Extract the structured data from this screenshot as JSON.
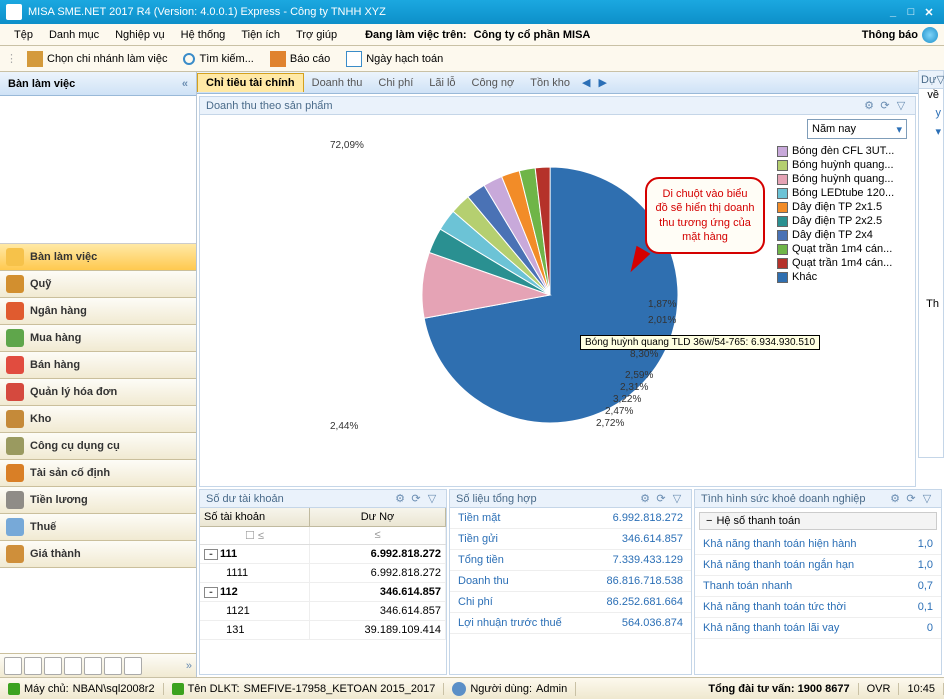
{
  "window": {
    "title": "MISA SME.NET 2017 R4 (Version: 4.0.0.1) Express - Công ty TNHH XYZ"
  },
  "menu": {
    "items": [
      "Tệp",
      "Danh mục",
      "Nghiệp vụ",
      "Hệ thống",
      "Tiện ích",
      "Trợ giúp"
    ],
    "working_on_label": "Đang làm việc trên:",
    "working_on_value": "Công ty cổ phần MISA",
    "notify": "Thông báo"
  },
  "toolbar": {
    "branch": "Chọn chi nhánh làm việc",
    "search": "Tìm kiếm...",
    "report": "Báo cáo",
    "accounting_date": "Ngày hạch toán"
  },
  "sidebar": {
    "title": "Bàn làm việc",
    "items": [
      {
        "label": "Bàn làm việc",
        "active": true,
        "color": "#f6c24a"
      },
      {
        "label": "Quỹ",
        "color": "#d28f2f"
      },
      {
        "label": "Ngân hàng",
        "color": "#e05b2f"
      },
      {
        "label": "Mua hàng",
        "color": "#5fa64b"
      },
      {
        "label": "Bán hàng",
        "color": "#e14c3f"
      },
      {
        "label": "Quản lý hóa đơn",
        "color": "#d5493e"
      },
      {
        "label": "Kho",
        "color": "#c58a39"
      },
      {
        "label": "Công cụ dụng cụ",
        "color": "#9a9a60"
      },
      {
        "label": "Tài sản cố định",
        "color": "#d97f26"
      },
      {
        "label": "Tiền lương",
        "color": "#8f8c87"
      },
      {
        "label": "Thuế",
        "color": "#77a9d8"
      },
      {
        "label": "Giá thành",
        "color": "#cf8f3a"
      }
    ]
  },
  "tabs": {
    "items": [
      "Chỉ tiêu tài chính",
      "Doanh thu",
      "Chi phí",
      "Lãi lỗ",
      "Công nợ",
      "Tồn kho"
    ]
  },
  "chart": {
    "title": "Doanh thu theo sản phẩm",
    "period": "Năm nay",
    "callout": "Di chuột vào biểu đồ sẽ hiển thị doanh thu tương ứng của mặt hàng",
    "tooltip": "Bóng huỳnh quang TLD 36w/54-765: 6.934.930.510",
    "legend": [
      {
        "label": "Bóng đèn CFL 3UT...",
        "color": "#c8a9da"
      },
      {
        "label": "Bóng huỳnh quang...",
        "color": "#b5cf70"
      },
      {
        "label": "Bóng huỳnh quang...",
        "color": "#e5a3b5"
      },
      {
        "label": "Bóng LEDtube 120...",
        "color": "#6cc3d6"
      },
      {
        "label": "Dây điện TP 2x1.5",
        "color": "#f28c28"
      },
      {
        "label": "Dây điện TP 2x2.5",
        "color": "#2a9091"
      },
      {
        "label": "Dây điện TP 2x4",
        "color": "#4a72b5"
      },
      {
        "label": "Quạt trần 1m4 cán...",
        "color": "#6fb548"
      },
      {
        "label": "Quạt trần 1m4 cán...",
        "color": "#b5322a"
      },
      {
        "label": "Khác",
        "color": "#2f6fb0"
      }
    ],
    "labels": {
      "p7209": "72,09%",
      "p244": "2,44%",
      "p272": "2,72%",
      "p247": "2,47%",
      "p322": "3,22%",
      "p231": "2,31%",
      "p259": "2,59%",
      "p830": "8,30%",
      "p201": "2,01%",
      "p187": "1,87%"
    }
  },
  "chart_data": {
    "type": "pie",
    "title": "Doanh thu theo sản phẩm",
    "series": [
      {
        "name": "Khác",
        "value": 72.09,
        "color": "#2f6fb0"
      },
      {
        "name": "Bóng huỳnh quang TLD 36w/54-765",
        "value": 8.3,
        "color": "#e5a3b5",
        "amount": 6934930510
      },
      {
        "name": "Dây điện TP 2x2.5",
        "value": 3.22,
        "color": "#2a9091"
      },
      {
        "name": "Bóng LEDtube 120",
        "value": 2.72,
        "color": "#6cc3d6"
      },
      {
        "name": "Bóng huỳnh quang",
        "value": 2.59,
        "color": "#b5cf70"
      },
      {
        "name": "Dây điện TP 2x4",
        "value": 2.47,
        "color": "#4a72b5"
      },
      {
        "name": "Bóng đèn CFL 3UT",
        "value": 2.44,
        "color": "#c8a9da"
      },
      {
        "name": "Dây điện TP 2x1.5",
        "value": 2.31,
        "color": "#f28c28"
      },
      {
        "name": "Quạt trần 1m4 cánh",
        "value": 2.01,
        "color": "#6fb548"
      },
      {
        "name": "Quạt trần 1m4 cánh",
        "value": 1.87,
        "color": "#b5322a"
      }
    ]
  },
  "balance": {
    "title": "Số dư tài khoản",
    "col_acc": "Số tài khoản",
    "col_debit": "Dư Nợ",
    "rows": [
      {
        "acc": "111",
        "val": "6.992.818.272",
        "bold": true,
        "toggle": "-"
      },
      {
        "acc": "1111",
        "val": "6.992.818.272"
      },
      {
        "acc": "112",
        "val": "346.614.857",
        "bold": true,
        "toggle": "-"
      },
      {
        "acc": "1121",
        "val": "346.614.857"
      },
      {
        "acc": "131",
        "val": "39.189.109.414"
      }
    ]
  },
  "summary": {
    "title": "Số liệu tổng hợp",
    "rows": [
      {
        "k": "Tiền mặt",
        "v": "6.992.818.272"
      },
      {
        "k": "Tiền gửi",
        "v": "346.614.857"
      },
      {
        "k": "Tổng tiền",
        "v": "7.339.433.129"
      },
      {
        "k": "Doanh thu",
        "v": "86.816.718.538"
      },
      {
        "k": "Chi phí",
        "v": "86.252.681.664"
      },
      {
        "k": "Lợi nhuận trước thuế",
        "v": "564.036.874"
      }
    ]
  },
  "health": {
    "title": "Tình hình sức khoẻ doanh nghiệp",
    "group": "Hệ số thanh toán",
    "rows": [
      {
        "k": "Khả năng thanh toán hiện hành",
        "v": "1,0"
      },
      {
        "k": "Khả năng thanh toán ngắn hạn",
        "v": "1,0"
      },
      {
        "k": "Thanh toán nhanh",
        "v": "0,7"
      },
      {
        "k": "Khả năng thanh toán tức thời",
        "v": "0,1"
      },
      {
        "k": "Khả năng thanh toán lãi vay",
        "v": "0"
      }
    ]
  },
  "rsliver": {
    "h": "Dự",
    "h2": "về",
    "y": "y",
    "th": "Th"
  },
  "status": {
    "server_lbl": "Máy chủ:",
    "server": "NBAN\\sql2008r2",
    "db_lbl": "Tên DLKT:",
    "db": "SMEFIVE-17958_KETOAN 2015_2017",
    "user_lbl": "Người dùng:",
    "user": "Admin",
    "hotline_lbl": "Tổng đài tư vấn:",
    "hotline": "1900 8677",
    "ovr": "OVR",
    "time": "10:45"
  }
}
